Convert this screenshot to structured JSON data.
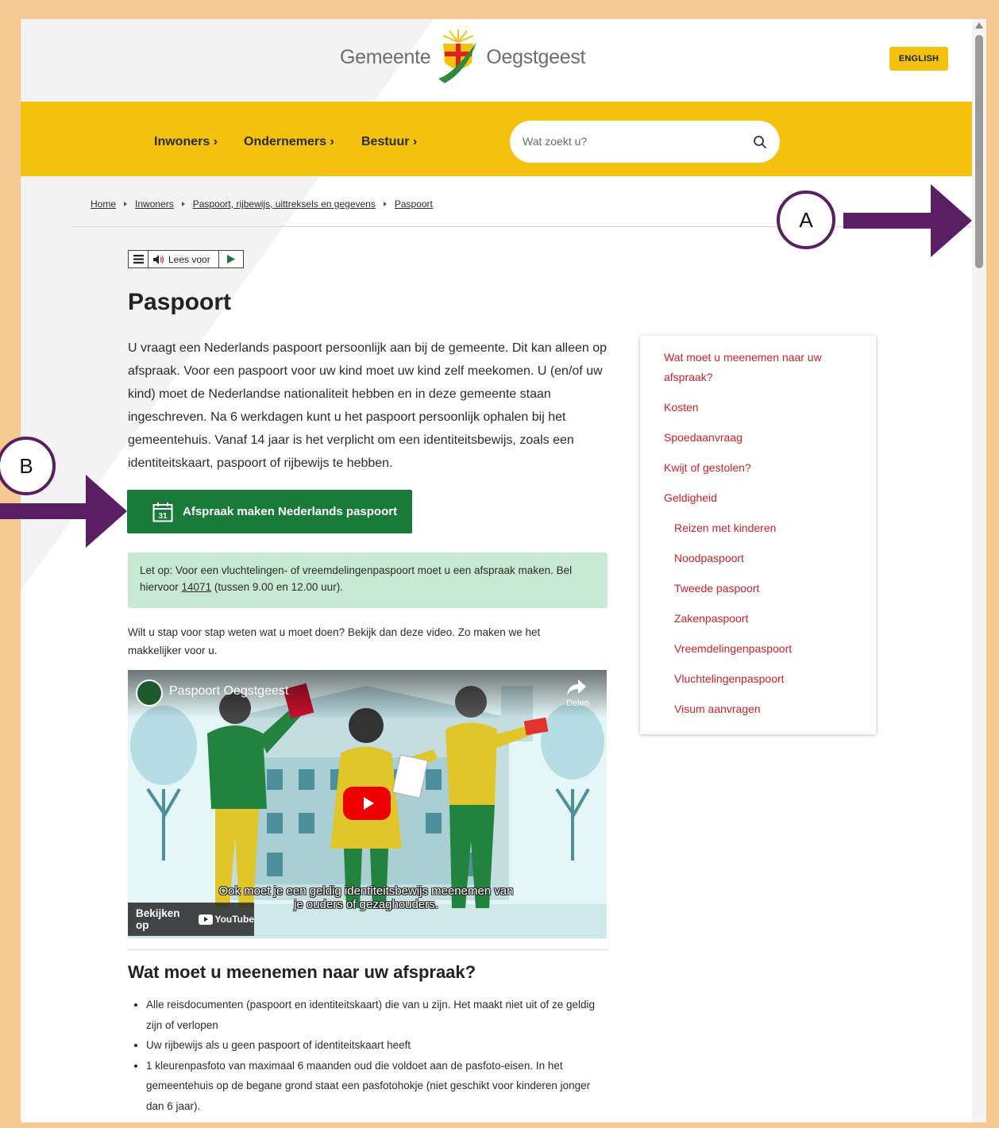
{
  "header": {
    "logo_left": "Gemeente",
    "logo_right": "Oegstgeest",
    "english_label": "ENGLISH"
  },
  "nav": {
    "items": [
      {
        "label": "Inwoners ›"
      },
      {
        "label": "Ondernemers ›"
      },
      {
        "label": "Bestuur ›"
      }
    ],
    "search_placeholder": "Wat zoekt u?"
  },
  "breadcrumb": [
    "Home",
    "Inwoners",
    "Paspoort, rijbewijs, uittreksels en gegevens",
    "Paspoort"
  ],
  "readspeaker": {
    "label": "Lees voor"
  },
  "page": {
    "title": "Paspoort",
    "intro": "U vraagt een Nederlands paspoort persoonlijk aan bij de gemeente. Dit kan alleen op afspraak. Voor een paspoort voor uw kind moet uw kind zelf meekomen. U (en/of uw kind) moet de Nederlandse nationaliteit hebben en in deze gemeente staan ingeschreven. Na 6 werkdagen kunt u het paspoort persoonlijk ophalen bij het gemeentehuis. Vanaf 14 jaar is het verplicht om een identiteitsbewijs, zoals een identiteitskaart, paspoort of rijbewijs te hebben.",
    "appointment_button": "Afspraak maken Nederlands paspoort",
    "calendar_day": "31",
    "notice_before": "Let op: Voor een vluchtelingen- of vreemdelingenpaspoort moet u een afspraak maken. Bel hiervoor ",
    "notice_phone": "14071",
    "notice_after": " (tussen 9.00 en 12.00 uur).",
    "video_intro": "Wilt u stap voor stap weten wat u moet doen? Bekijk dan deze video. Zo maken we het makkelijker voor u.",
    "section_heading": "Wat moet u meenemen naar uw afspraak?",
    "bring_list": [
      "Alle reisdocumenten (paspoort en identiteitskaart) die van u zijn. Het maakt niet uit of ze geldig zijn of verlopen",
      "Uw rijbewijs als u geen paspoort of identiteitskaart heeft",
      "1 kleurenpasfoto van maximaal 6 maanden oud die voldoet aan de pasfoto-eisen. In het gemeentehuis op de begane grond staat een pasfotohokje (niet geschikt voor kinderen jonger dan 6 jaar)."
    ]
  },
  "video": {
    "title": "Paspoort Oegstgeest",
    "share_label": "Delen",
    "subtitle_line1": "Ook moet je een geldig identiteitsbewijs meenemen van",
    "subtitle_line2": "je ouders of gezaghouders.",
    "watch_on": "Bekijken op",
    "youtube": "YouTube"
  },
  "toc": {
    "items": [
      "Wat moet u meenemen naar uw afspraak?",
      "Kosten",
      "Spoedaanvraag",
      "Kwijt of gestolen?",
      "Geldigheid",
      "Reizen met kinderen",
      "Noodpaspoort",
      "Tweede paspoort",
      "Zakenpaspoort",
      "Vreemdelingenpaspoort",
      "Vluchtelingenpaspoort",
      "Visum aanvragen"
    ]
  },
  "annotations": {
    "marker_a": "A",
    "marker_b": "B",
    "color": "#5a1f63"
  },
  "colors": {
    "brand_yellow": "#f4c10f",
    "button_green": "#197a3a",
    "link_red": "#d0202a",
    "notice_green": "#c7e9d3",
    "frame": "#f6c892"
  }
}
